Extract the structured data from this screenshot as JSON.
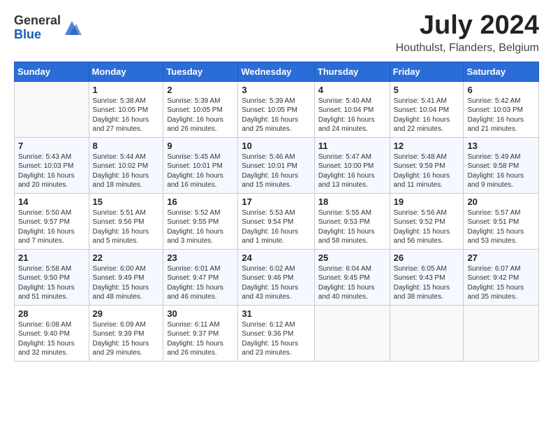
{
  "header": {
    "logo_general": "General",
    "logo_blue": "Blue",
    "month_year": "July 2024",
    "location": "Houthulst, Flanders, Belgium"
  },
  "days_of_week": [
    "Sunday",
    "Monday",
    "Tuesday",
    "Wednesday",
    "Thursday",
    "Friday",
    "Saturday"
  ],
  "weeks": [
    [
      {
        "day": "",
        "text": ""
      },
      {
        "day": "1",
        "text": "Sunrise: 5:38 AM\nSunset: 10:05 PM\nDaylight: 16 hours and 27 minutes."
      },
      {
        "day": "2",
        "text": "Sunrise: 5:39 AM\nSunset: 10:05 PM\nDaylight: 16 hours and 26 minutes."
      },
      {
        "day": "3",
        "text": "Sunrise: 5:39 AM\nSunset: 10:05 PM\nDaylight: 16 hours and 25 minutes."
      },
      {
        "day": "4",
        "text": "Sunrise: 5:40 AM\nSunset: 10:04 PM\nDaylight: 16 hours and 24 minutes."
      },
      {
        "day": "5",
        "text": "Sunrise: 5:41 AM\nSunset: 10:04 PM\nDaylight: 16 hours and 22 minutes."
      },
      {
        "day": "6",
        "text": "Sunrise: 5:42 AM\nSunset: 10:03 PM\nDaylight: 16 hours and 21 minutes."
      }
    ],
    [
      {
        "day": "7",
        "text": "Sunrise: 5:43 AM\nSunset: 10:03 PM\nDaylight: 16 hours and 20 minutes."
      },
      {
        "day": "8",
        "text": "Sunrise: 5:44 AM\nSunset: 10:02 PM\nDaylight: 16 hours and 18 minutes."
      },
      {
        "day": "9",
        "text": "Sunrise: 5:45 AM\nSunset: 10:01 PM\nDaylight: 16 hours and 16 minutes."
      },
      {
        "day": "10",
        "text": "Sunrise: 5:46 AM\nSunset: 10:01 PM\nDaylight: 16 hours and 15 minutes."
      },
      {
        "day": "11",
        "text": "Sunrise: 5:47 AM\nSunset: 10:00 PM\nDaylight: 16 hours and 13 minutes."
      },
      {
        "day": "12",
        "text": "Sunrise: 5:48 AM\nSunset: 9:59 PM\nDaylight: 16 hours and 11 minutes."
      },
      {
        "day": "13",
        "text": "Sunrise: 5:49 AM\nSunset: 9:58 PM\nDaylight: 16 hours and 9 minutes."
      }
    ],
    [
      {
        "day": "14",
        "text": "Sunrise: 5:50 AM\nSunset: 9:57 PM\nDaylight: 16 hours and 7 minutes."
      },
      {
        "day": "15",
        "text": "Sunrise: 5:51 AM\nSunset: 9:56 PM\nDaylight: 16 hours and 5 minutes."
      },
      {
        "day": "16",
        "text": "Sunrise: 5:52 AM\nSunset: 9:55 PM\nDaylight: 16 hours and 3 minutes."
      },
      {
        "day": "17",
        "text": "Sunrise: 5:53 AM\nSunset: 9:54 PM\nDaylight: 16 hours and 1 minute."
      },
      {
        "day": "18",
        "text": "Sunrise: 5:55 AM\nSunset: 9:53 PM\nDaylight: 15 hours and 58 minutes."
      },
      {
        "day": "19",
        "text": "Sunrise: 5:56 AM\nSunset: 9:52 PM\nDaylight: 15 hours and 56 minutes."
      },
      {
        "day": "20",
        "text": "Sunrise: 5:57 AM\nSunset: 9:51 PM\nDaylight: 15 hours and 53 minutes."
      }
    ],
    [
      {
        "day": "21",
        "text": "Sunrise: 5:58 AM\nSunset: 9:50 PM\nDaylight: 15 hours and 51 minutes."
      },
      {
        "day": "22",
        "text": "Sunrise: 6:00 AM\nSunset: 9:49 PM\nDaylight: 15 hours and 48 minutes."
      },
      {
        "day": "23",
        "text": "Sunrise: 6:01 AM\nSunset: 9:47 PM\nDaylight: 15 hours and 46 minutes."
      },
      {
        "day": "24",
        "text": "Sunrise: 6:02 AM\nSunset: 9:46 PM\nDaylight: 15 hours and 43 minutes."
      },
      {
        "day": "25",
        "text": "Sunrise: 6:04 AM\nSunset: 9:45 PM\nDaylight: 15 hours and 40 minutes."
      },
      {
        "day": "26",
        "text": "Sunrise: 6:05 AM\nSunset: 9:43 PM\nDaylight: 15 hours and 38 minutes."
      },
      {
        "day": "27",
        "text": "Sunrise: 6:07 AM\nSunset: 9:42 PM\nDaylight: 15 hours and 35 minutes."
      }
    ],
    [
      {
        "day": "28",
        "text": "Sunrise: 6:08 AM\nSunset: 9:40 PM\nDaylight: 15 hours and 32 minutes."
      },
      {
        "day": "29",
        "text": "Sunrise: 6:09 AM\nSunset: 9:39 PM\nDaylight: 15 hours and 29 minutes."
      },
      {
        "day": "30",
        "text": "Sunrise: 6:11 AM\nSunset: 9:37 PM\nDaylight: 15 hours and 26 minutes."
      },
      {
        "day": "31",
        "text": "Sunrise: 6:12 AM\nSunset: 9:36 PM\nDaylight: 15 hours and 23 minutes."
      },
      {
        "day": "",
        "text": ""
      },
      {
        "day": "",
        "text": ""
      },
      {
        "day": "",
        "text": ""
      }
    ]
  ]
}
